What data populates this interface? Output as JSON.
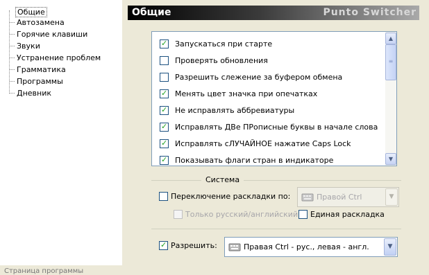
{
  "tree": {
    "items": [
      "Общие",
      "Автозамена",
      "Горячие клавиши",
      "Звуки",
      "Устранение проблем",
      "Грамматика",
      "Программы",
      "Дневник"
    ],
    "selected_index": 0
  },
  "header": {
    "title": "Общие",
    "brand": "Punto Switcher"
  },
  "options": [
    {
      "label": "Запускаться при старте",
      "checked": true
    },
    {
      "label": "Проверять обновления",
      "checked": false
    },
    {
      "label": "Разрешить слежение за буфером обмена",
      "checked": false
    },
    {
      "label": "Менять цвет значка при опечатках",
      "checked": true
    },
    {
      "label": "Не исправлять аббревиатуры",
      "checked": true
    },
    {
      "label": "Исправлять ДВе ПРописные буквы в начале слова",
      "checked": true
    },
    {
      "label": "Исправлять сЛУЧАЙНОЕ нажатие Caps Lock",
      "checked": true
    },
    {
      "label": "Показывать флаги стран в индикаторе",
      "checked": true
    }
  ],
  "system": {
    "title": "Система",
    "switch_layout": {
      "label": "Переключение раскладки по:",
      "checked": false
    },
    "switch_combo": {
      "value": "Правой Ctrl",
      "enabled": false
    },
    "only_ru_en": {
      "label": "Только русский/английский",
      "checked": false,
      "enabled": false
    },
    "single_layout": {
      "label": "Единая раскладка",
      "checked": false
    }
  },
  "allow": {
    "label": "Разрешить:",
    "checked": true,
    "combo": {
      "value": "Правая Ctrl - рус., левая - англ."
    }
  },
  "status_text": "Страница программы",
  "colors": {
    "check": "#21a121",
    "border": "#7f9db9",
    "panel": "#ece9d8"
  },
  "icons": {
    "checked": "✓",
    "scroll_up": "▲",
    "scroll_down": "▼",
    "dropdown": "▼"
  }
}
